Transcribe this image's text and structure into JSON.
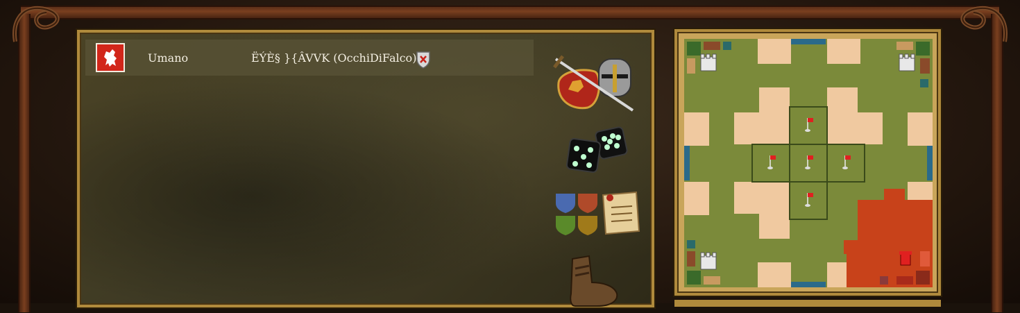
{
  "lobby": {
    "player": {
      "name": "Umano",
      "clan": "ËÝÈ§ }{ÂVVK (OcchiDiFalco)",
      "faction_color": "#d2261a",
      "faction_emblem": "lion-rampant-icon"
    },
    "kick_icon": "shield-x-icon",
    "side_buttons": [
      {
        "icon": "sword-helmet-shield-icon"
      },
      {
        "icon": "dice-icon"
      },
      {
        "icon": "faction-shields-scroll-icon"
      },
      {
        "icon": "boot-icon"
      }
    ]
  },
  "map": {
    "terrain_color": "#7b8a3a",
    "sand_color": "#f0c9a0",
    "player_territory_color": "#c8421a",
    "water_color": "#2a6a8a",
    "castle_icon": "castle-icon",
    "flag_icon": "red-flag-icon",
    "player_castle_icon": "red-tower-icon"
  }
}
